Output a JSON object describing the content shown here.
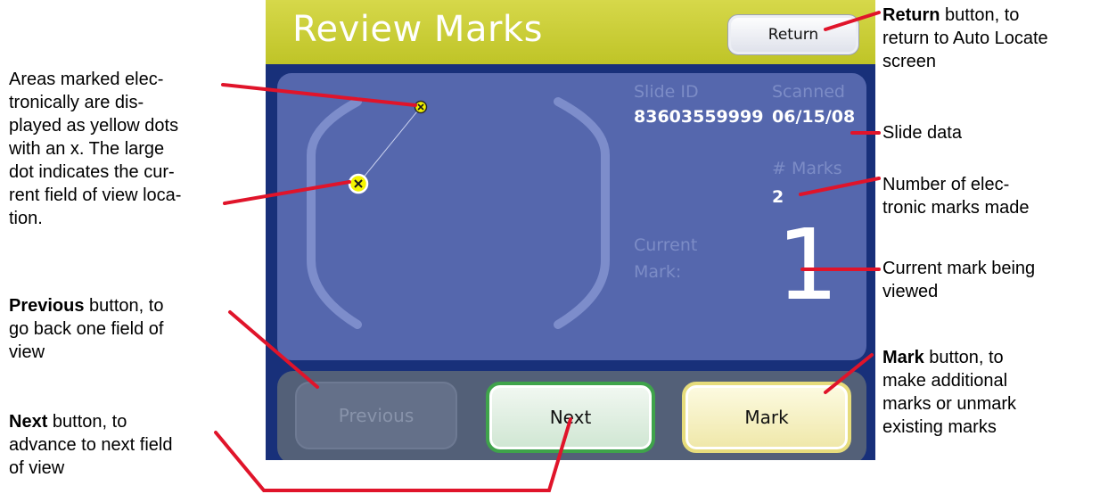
{
  "screen": {
    "title": "Review Marks",
    "return_label": "Return",
    "slide_id_label": "Slide ID",
    "slide_id_value": "83603559999",
    "scanned_label": "Scanned",
    "scanned_value": "06/15/08",
    "marks_label": "# Marks",
    "marks_value": "2",
    "current_label_1": "Current",
    "current_label_2": "Mark:",
    "current_value": "1",
    "buttons": {
      "previous": "Previous",
      "next": "Next",
      "mark": "Mark"
    }
  },
  "annotations": {
    "marks_dots": "Areas marked elec-\ntronically are dis-\nplayed as yellow dots\nwith an x. The large\ndot indicates the cur-\nrent field of view loca-\ntion.",
    "previous_bold": "Previous",
    "previous_rest": " button, to\ngo back one field of\nview",
    "next_bold": "Next",
    "next_rest": " button, to\nadvance to next field\nof view",
    "return_bold": "Return",
    "return_rest": " button, to\nreturn to Auto Locate\nscreen",
    "slide_data": "Slide data",
    "num_marks": "Number of elec-\ntronic marks made",
    "current_mark": "Current mark being\nviewed",
    "mark_bold": "Mark",
    "mark_rest": " button, to\nmake additional\nmarks or unmark\nexisting marks"
  },
  "colors": {
    "titlebar": "#c8cc35",
    "screen_bg": "#18307a",
    "panel": "#5567ad",
    "leader_lines": "#e0142a",
    "mark_dot": "#f0f000"
  },
  "icons": [
    "mark-dot-icon-small",
    "mark-dot-icon-large"
  ]
}
